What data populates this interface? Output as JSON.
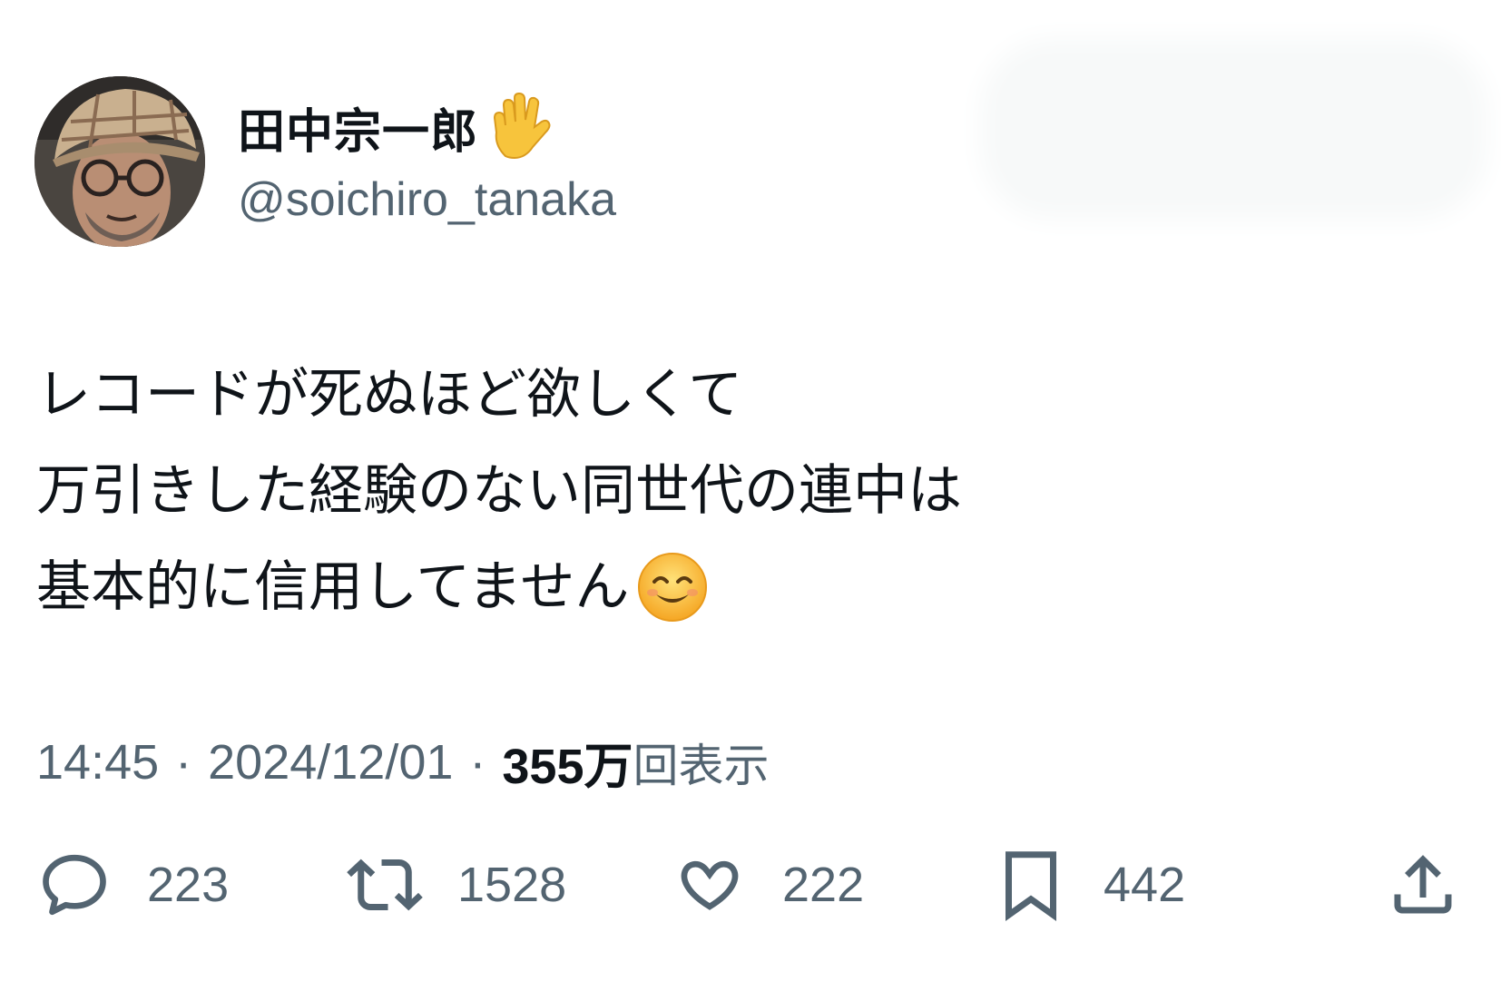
{
  "author": {
    "display_name": "田中宗一郎",
    "handle": "@soichiro_tanaka",
    "avatar_icon": "avatar-photo",
    "name_emoji": "vulcan-salute-emoji"
  },
  "tweet": {
    "lines": [
      "レコードが死ぬほど欲しくて",
      "万引きした経験のない同世代の連中は",
      "基本的に信用してません"
    ],
    "trailing_emoji": "smiling-face-emoji"
  },
  "meta": {
    "time": "14:45",
    "separator": "·",
    "date": "2024/12/01",
    "views_count": "355万",
    "views_label": "回表示"
  },
  "actions": {
    "reply": {
      "icon": "reply-icon",
      "count": "223"
    },
    "retweet": {
      "icon": "retweet-icon",
      "count": "1528"
    },
    "like": {
      "icon": "heart-icon",
      "count": "222"
    },
    "bookmark": {
      "icon": "bookmark-icon",
      "count": "442"
    },
    "share": {
      "icon": "share-icon"
    }
  },
  "colors": {
    "text_primary": "#0f1419",
    "text_secondary": "#536471",
    "icon": "#536471"
  }
}
